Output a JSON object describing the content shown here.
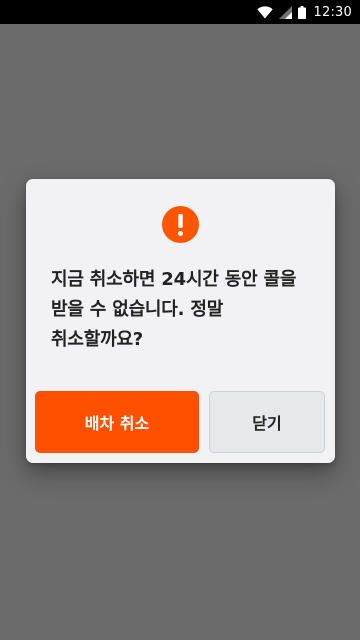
{
  "status_bar": {
    "time": "12:30",
    "icons": [
      "wifi-icon",
      "signal-icon",
      "battery-icon"
    ]
  },
  "dialog": {
    "icon": "alert-icon",
    "message": "지금 취소하면 24시간 동안 콜을 받을 수 없습니다. 정말 취소할까요?",
    "primary_button_label": "배차 취소",
    "secondary_button_label": "닫기"
  },
  "colors": {
    "accent": "#ff5000",
    "backdrop": "#6b6b6b",
    "dialog_background": "#f2f2f4",
    "secondary_button_background": "#e7e8ec",
    "text": "#222222"
  }
}
